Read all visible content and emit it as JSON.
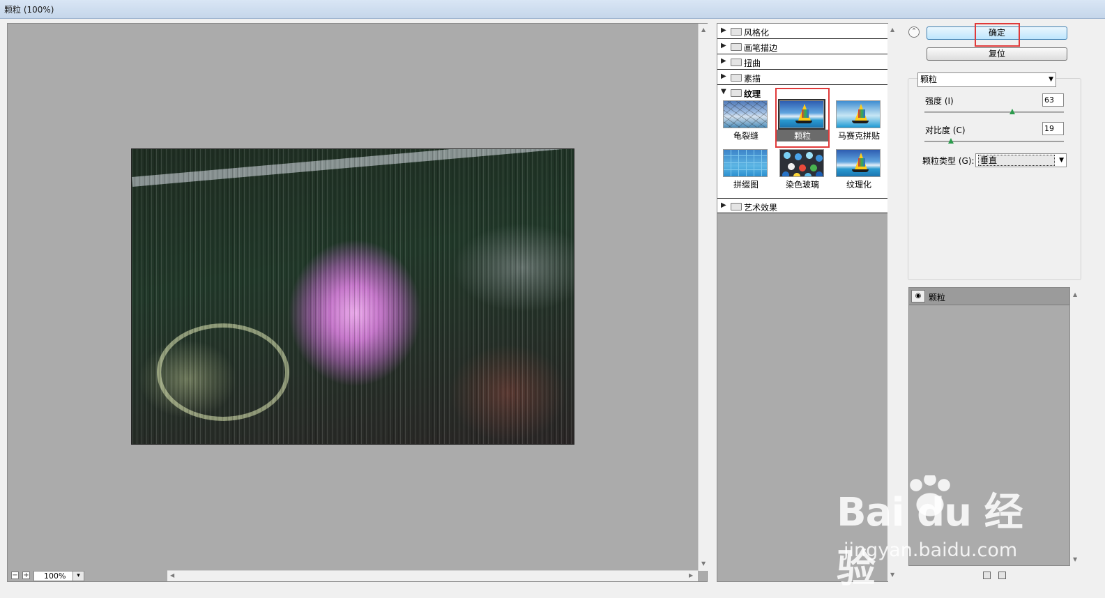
{
  "window": {
    "title": "颗粒 (100%)"
  },
  "preview": {
    "zoom": "100%",
    "zoom_out": "−",
    "zoom_in": "+",
    "dropdown_glyph": "▾"
  },
  "gallery": {
    "categories": [
      {
        "label": "风格化",
        "open": false
      },
      {
        "label": "画笔描边",
        "open": false
      },
      {
        "label": "扭曲",
        "open": false
      },
      {
        "label": "素描",
        "open": false
      },
      {
        "label": "纹理",
        "open": true
      },
      {
        "label": "艺术效果",
        "open": false
      }
    ],
    "texture_filters": [
      {
        "label": "龟裂缝",
        "icon": "craquelure-thumbnail"
      },
      {
        "label": "颗粒",
        "icon": "grain-thumbnail",
        "selected": true
      },
      {
        "label": "马赛克拼贴",
        "icon": "mosaic-tiles-thumbnail"
      },
      {
        "label": "拼缀图",
        "icon": "patchwork-thumbnail"
      },
      {
        "label": "染色玻璃",
        "icon": "stained-glass-thumbnail"
      },
      {
        "label": "纹理化",
        "icon": "texturizer-thumbnail"
      }
    ]
  },
  "controls": {
    "ok_label": "确定",
    "reset_label": "复位",
    "filter_selected": "颗粒",
    "intensity_label": "强度 (I)",
    "intensity_value": "63",
    "intensity_level": 63,
    "contrast_label": "对比度 (C)",
    "contrast_value": "19",
    "contrast_level": 19,
    "grain_type_label": "颗粒类型 (G):",
    "grain_type_value": "垂直"
  },
  "layers": {
    "items": [
      {
        "label": "颗粒",
        "visible": true
      }
    ]
  },
  "watermark": {
    "brand": "Bai du 经验",
    "url": "jingyan.baidu.com"
  },
  "colors": {
    "highlight": "#e03a3a",
    "preview_bg": "#ababab"
  }
}
